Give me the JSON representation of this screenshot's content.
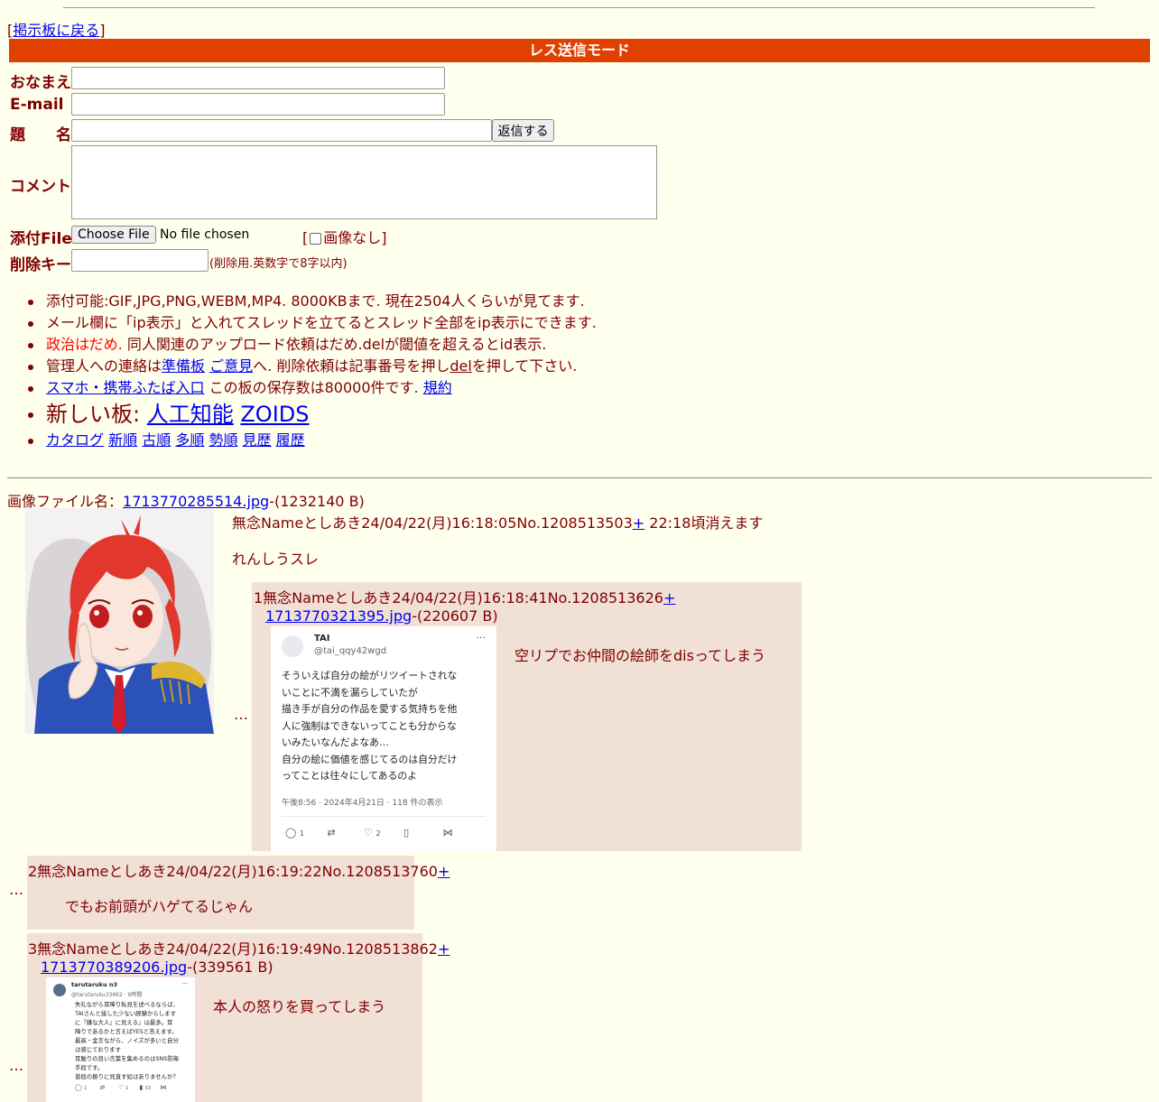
{
  "nav": {
    "back_open": "[",
    "back_link": "掲示板に戻る",
    "back_close": "]"
  },
  "mode_title": "レス送信モード",
  "form": {
    "name_label": "おなまえ",
    "email_label": "E-mail",
    "subject_label": "題　　名",
    "submit_label": "返信する",
    "comment_label": "コメント",
    "file_label": "添付File",
    "choose_file": "Choose File",
    "no_file": "No file chosen",
    "noimage_open": "[",
    "noimage_label": "画像なし",
    "noimage_close": "]",
    "delkey_label": "削除キー",
    "delkey_note": "(削除用.英数字で8字以内)"
  },
  "rules": {
    "r1": "添付可能:GIF,JPG,PNG,WEBM,MP4. 8000KBまで. 現在2504人くらいが見てます.",
    "r2": "メール欄に「ip表示」と入れてスレッドを立てるとスレッド全部をip表示にできます.",
    "r3_red": "政治はだめ.",
    "r3_rest": " 同人関連のアップロード依頼はだめ.delが閾値を超えるとid表示.",
    "r4_a": "管理人への連絡は",
    "r4_link1": "準備板",
    "r4_link2": "ご意見",
    "r4_b": "へ. 削除依頼は記事番号を押し",
    "r4_link3": "del",
    "r4_c": "を押して下さい.",
    "r5_link": "スマホ・携帯ふたば入口",
    "r5_text": " この板の保存数は80000件です. ",
    "r5_link2": "規約",
    "r6_text": "新しい板: ",
    "r6_link1": "人工知能",
    "r6_link2": "ZOIDS",
    "r7_links": [
      "カタログ",
      "新順",
      "古順",
      "多順",
      "勢順",
      "見歴",
      "履歴"
    ]
  },
  "op": {
    "file_prefix": "画像ファイル名：",
    "file_name": "1713770285514.jpg",
    "file_size": "-(1232140 B)",
    "header": "無念Nameとしあき24/04/22(月)16:18:05No.1208513503",
    "plus": "+",
    "expire": " 22:18頃消えます",
    "comment": "れんしうスレ"
  },
  "replies": [
    {
      "header": "1無念Nameとしあき24/04/22(月)16:18:41No.1208513626",
      "plus": "+",
      "file_name": "1713770321395.jpg",
      "file_size": "-(220607 B)",
      "comment": "空リプでお仲間の絵師をdisってしまう",
      "dots": "…",
      "tweet": {
        "name": "TAI",
        "handle": "@tai_qqy42wgd",
        "lines": [
          "そういえば自分の絵がリツイートされな",
          "いことに不満を漏らしていたが",
          "描き手が自分の作品を愛する気持ちを他",
          "人に強制はできないってことも分からな",
          "いみたいなんだよなあ…",
          "自分の絵に価値を感じてるのは自分だけ",
          "ってことは往々にしてあるのよ"
        ],
        "meta": "午後8:56 · 2024年4月21日 · 118 件の表示",
        "replies": "1",
        "likes": "2"
      }
    },
    {
      "header": "2無念Nameとしあき24/04/22(月)16:19:22No.1208513760",
      "plus": "+",
      "comment": "でもお前頭がハゲてるじゃん",
      "dots": "…"
    },
    {
      "header": "3無念Nameとしあき24/04/22(月)16:19:49No.1208513862",
      "plus": "+",
      "file_name": "1713770389206.jpg",
      "file_size": "-(339561 B)",
      "comment": "本人の怒りを買ってしまう",
      "dots": "…",
      "tweet": {
        "name": "tarutaruku n3",
        "handle": "@tarutaruku33662 · 9時間",
        "lines": [
          "失礼ながら耳障り私見を述べるならば、",
          "TAIさんと接した少ない経験からします",
          "に『嫌な大人』に見える』は最多。耳",
          "障りであるかと言えばYESと答えます。",
          "最高・金言ながら、ノイズが多いと自分",
          "は感じております",
          "耳触りの良い言葉を集めるのはSNS防衛",
          "手段です。",
          "普段の振りに見直す処はありませんか？"
        ],
        "replies": "1",
        "likes": "1",
        "views": "33"
      }
    }
  ],
  "colors": {
    "background": "#ffffee",
    "text": "#800000",
    "header_bar": "#e04000",
    "reply_bg": "#f0e0d6",
    "link": "#0000ee"
  }
}
